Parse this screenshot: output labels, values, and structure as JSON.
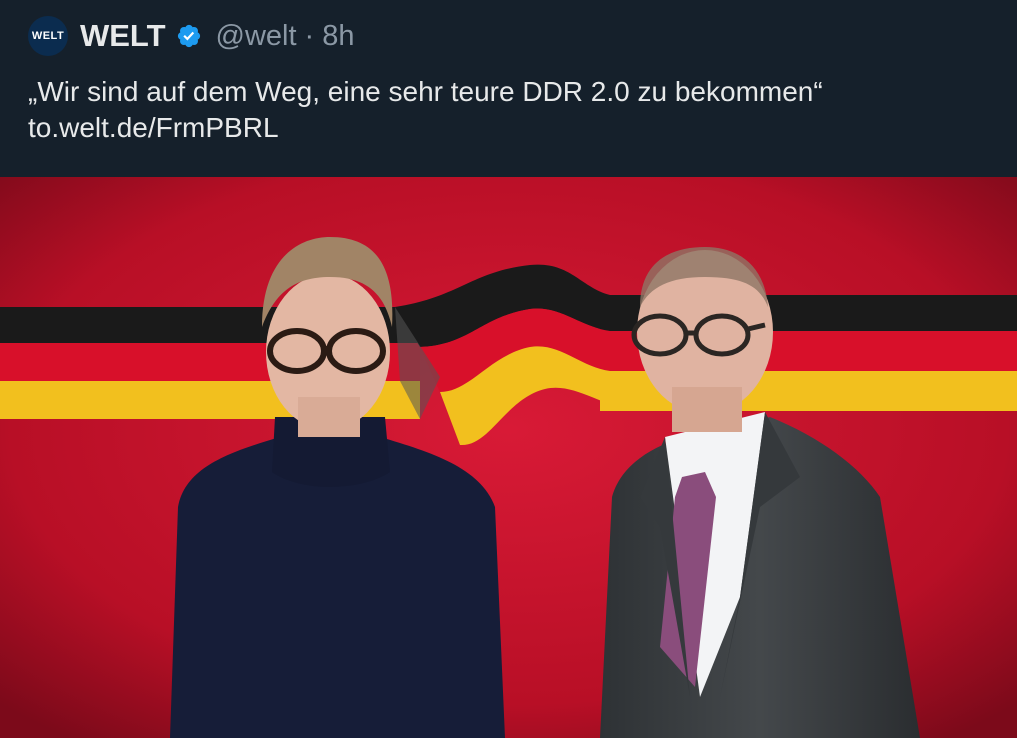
{
  "account": {
    "avatar_text": "WELT",
    "name": "WELT",
    "handle": "@welt",
    "separator": "·",
    "time": "8h",
    "verified_icon": "verified-badge-icon"
  },
  "tweet": {
    "text": "„Wir sind auf dem Weg, eine sehr teure DDR 2.0 zu bekommen“",
    "link": "to.welt.de/FrmPBRL"
  },
  "media": {
    "description_icon": "photo-image",
    "colors": {
      "background_red": "#c4122a",
      "flag_black": "#1a1a1a",
      "flag_red": "#d8102a",
      "flag_gold": "#f2c01e",
      "sweater_navy": "#161d38",
      "suit_gray": "#3e4245",
      "tie_purple": "#8a4d7c"
    }
  },
  "colors": {
    "background": "#15202b",
    "text_primary": "#e7e9ea",
    "text_secondary": "#8b98a5",
    "verified_blue": "#1d9bf0"
  }
}
